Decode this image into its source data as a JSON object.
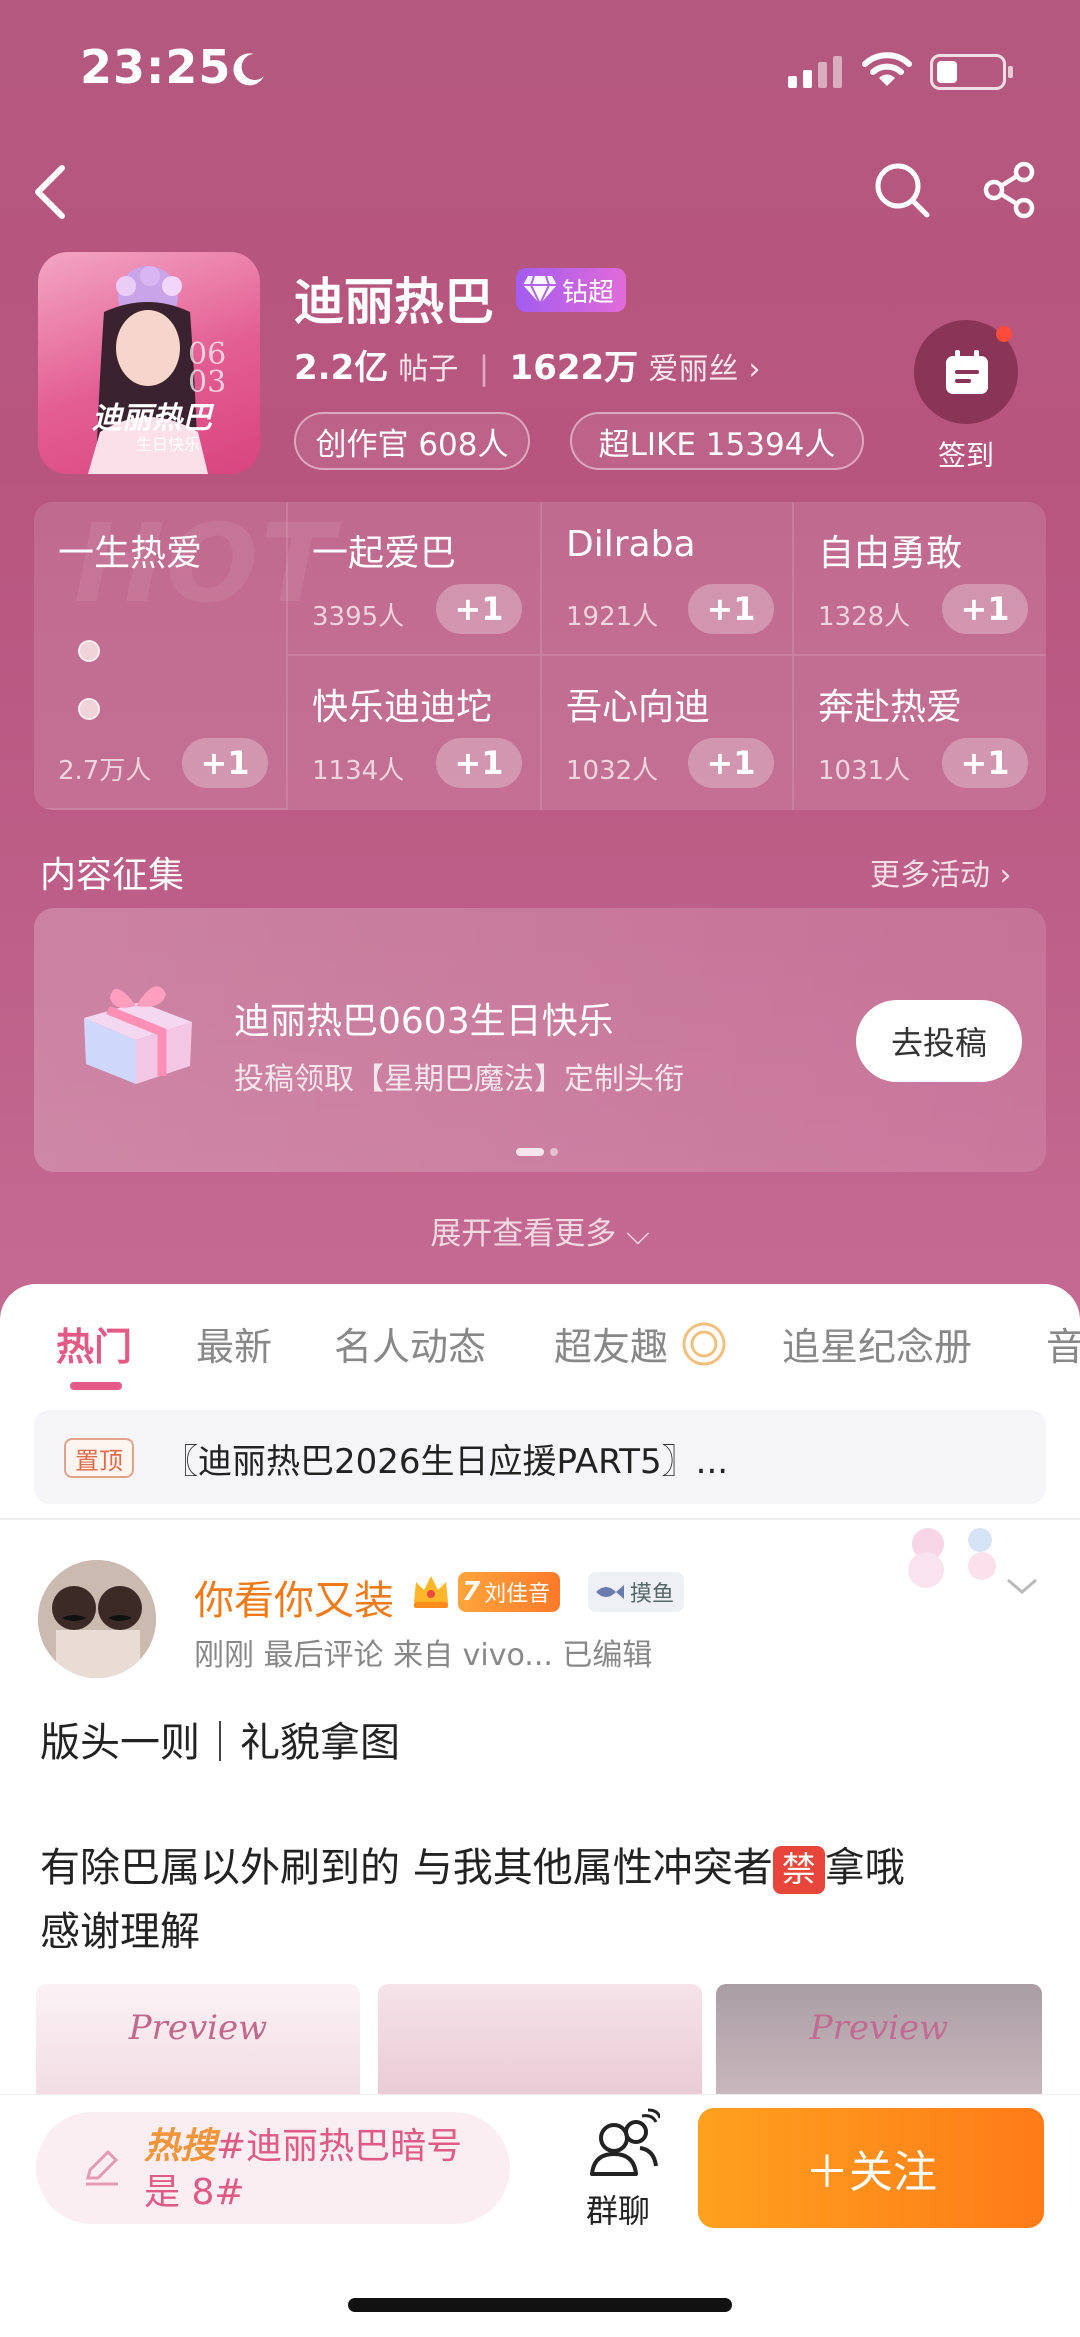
{
  "status": {
    "time": "23:25"
  },
  "community": {
    "title": "迪丽热巴",
    "badge": "钻超",
    "posts_count": "2.2亿",
    "posts_label": "帖子",
    "fans_count": "1622万",
    "fans_label": "爱丽丝",
    "creators": "创作官 608人",
    "super_like": "超LIKE 15394人",
    "checkin_label": "签到"
  },
  "groups": [
    {
      "name": "一生热爱",
      "count": "2.7万人",
      "plus": "+1"
    },
    {
      "name": "一起爱巴",
      "count": "3395人",
      "plus": "+1"
    },
    {
      "name": "Dilraba",
      "count": "1921人",
      "plus": "+1"
    },
    {
      "name": "自由勇敢",
      "count": "1328人",
      "plus": "+1"
    },
    {
      "name": "快乐迪迪坨",
      "count": "1134人",
      "plus": "+1"
    },
    {
      "name": "吾心向迪",
      "count": "1032人",
      "plus": "+1"
    },
    {
      "name": "奔赴热爱",
      "count": "1031人",
      "plus": "+1"
    }
  ],
  "watermark": "HOT",
  "content_collect": {
    "title": "内容征集",
    "more": "更多活动",
    "banner_title": "迪丽热巴0603生日快乐",
    "banner_sub": "投稿领取【星期巴魔法】定制头衔",
    "submit": "去投稿"
  },
  "expand": "展开查看更多",
  "tabs": [
    "热门",
    "最新",
    "名人动态",
    "超友趣",
    "追星纪念册",
    "音"
  ],
  "pinned": {
    "tag": "置顶",
    "text": "〖迪丽热巴2026生日应援PART5〗..."
  },
  "post": {
    "username": "你看你又装",
    "level": "7",
    "level_label": "刘佳音",
    "fish_label": "摸鱼",
    "meta": "刚刚  最后评论  来自 vivo...  已编辑",
    "line1": "版头一则｜礼貌拿图",
    "line2a": "有除巴属以外刷到的 与我其他属性冲突者",
    "ban": "禁",
    "line2b": "拿哦",
    "line3": "感谢理解",
    "thumb_label": "Preview"
  },
  "bottom": {
    "hot_prefix": "热搜",
    "hot_text": "#迪丽热巴暗号是 8#",
    "group_chat": "群聊",
    "follow": "＋关注"
  },
  "colors": {
    "accent": "#e35a86",
    "follow": "#ff8c1a",
    "header_bg": "#b8557f"
  }
}
